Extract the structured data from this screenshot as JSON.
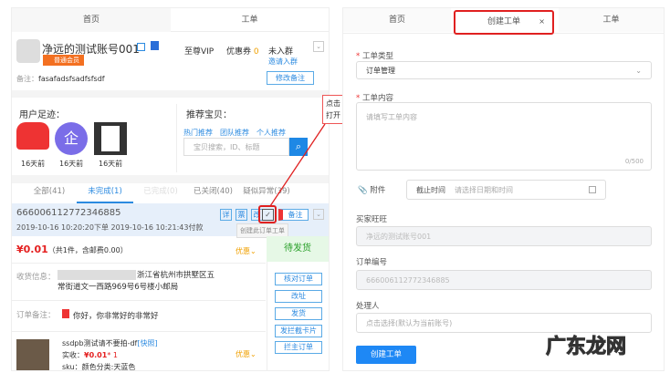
{
  "left": {
    "tabs": [
      "首页",
      "工单"
    ],
    "user": {
      "name": "净远的测试账号001",
      "badge": "普通会员",
      "remark_label": "备注：",
      "remark": "fasafadsfsadfsfsdf",
      "vip": "至尊VIP",
      "coupon_label": "优惠券",
      "coupon_count": "0",
      "group": "未入群",
      "invite": "邀请入群",
      "edit_remark": "修改备注"
    },
    "footprint": {
      "title": "用户足迹：",
      "items": [
        "16天前",
        "16天前",
        "16天前"
      ]
    },
    "recommend": {
      "title": "推荐宝贝：",
      "links": [
        "热门推荐",
        "团队推荐",
        "个人推荐"
      ],
      "search_placeholder": "宝贝搜索，ID、标题"
    },
    "order_tabs": [
      "全部(41)",
      "未完成(1)",
      "已完成(0)",
      "已关闭(40)",
      "疑似异常(39)"
    ],
    "order": {
      "id": "666006112772346885",
      "time": "2019-10-16 10:20:20下单  2019-10-16 10:21:43付款",
      "icons": [
        "详",
        "票",
        "改"
      ],
      "remark_btn": "备注",
      "tooltip": "创建此订单工单",
      "price": "¥0.01",
      "price_detail": "（共1件，含邮费0.00）",
      "discount": "优惠",
      "status": "待发货",
      "address_label": "收货信息：",
      "address": "浙江省杭州市拱墅区五常街道文一西路969号6号楼小邮局",
      "remark_label": "订单备注：",
      "remark": "你好，你非常好的非常好",
      "product": {
        "title": "ssdpb测试请不要拍-df",
        "snapshot": "[快照]",
        "paid_label": "实收：",
        "paid": "¥0.01",
        "qty": "* 1",
        "sku": "sku：颜色分类:天蓝色"
      },
      "actions": [
        "核对订单",
        "改址",
        "发货",
        "发拦截卡片",
        "拦主订单"
      ]
    }
  },
  "annotation": {
    "text1": "点击",
    "text2": "打开"
  },
  "right": {
    "tabs": [
      "首页",
      "创建工单",
      "工单"
    ],
    "close": "×",
    "type_label": "工单类型",
    "type_value": "订单管理",
    "content_label": "工单内容",
    "content_placeholder": "请填写工单内容",
    "counter": "0/500",
    "attach": "附件",
    "deadline_label": "截止时间",
    "deadline_placeholder": "请选择日期和时间",
    "buyer_label": "买家旺旺",
    "buyer": "净远的测试账号001",
    "order_label": "订单编号",
    "order": "666006112772346885",
    "handler_label": "处理人",
    "handler_placeholder": "点击选择(默认为当前账号)",
    "submit": "创建工单"
  },
  "watermark": "广东龙网"
}
